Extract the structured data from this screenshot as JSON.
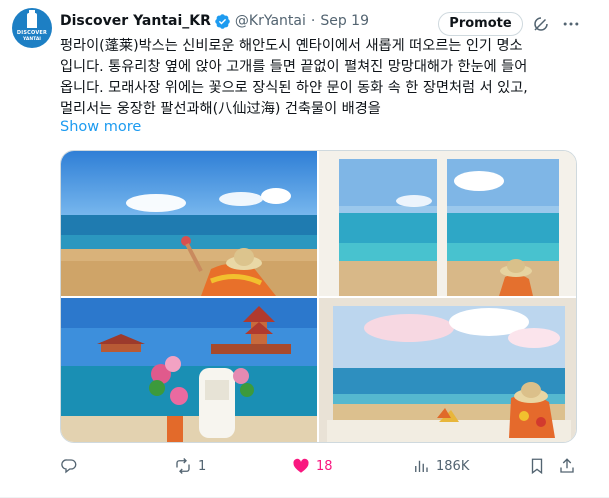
{
  "account": {
    "avatar_line1": "DISCOVER",
    "avatar_line2": "YANTAI",
    "display_name": "Discover Yantai_KR",
    "handle": "@KrYantai",
    "separator": "·",
    "date": "Sep 19",
    "verified_icon": "verified-badge-icon"
  },
  "header_actions": {
    "promote_label": "Promote",
    "grok_icon": "grok-icon",
    "more_icon": "more-icon"
  },
  "post": {
    "lines": [
      "펑라이(蓬莱)박스는 신비로운 해안도시 옌타이에서 새롭게 떠오르는 인기 명소",
      "입니다. 통유리창 옆에 앉아 고개를 들면 끝없이 펼쳐진 망망대해가 한눈에 들어",
      "옵니다. 모래사장 위에는 꽃으로 장식된 하얀 문이 동화 속 한 장면처럼 서 있고,",
      "멀리서는 웅장한 팔선과해(八仙过海) 건축물이 배경을"
    ],
    "show_more": "Show more"
  },
  "media": {
    "photos": [
      "photo-beach-sitting",
      "photo-window-ocean",
      "photo-flower-door-pavilion",
      "photo-window-ledge-ocean"
    ]
  },
  "actions": {
    "reply": {
      "icon": "reply-icon",
      "count": ""
    },
    "repost": {
      "icon": "repost-icon",
      "count": "1"
    },
    "like": {
      "icon": "heart-icon",
      "count": "18",
      "color": "#f91880"
    },
    "views": {
      "icon": "views-icon",
      "count": "186K"
    },
    "bookmark": {
      "icon": "bookmark-icon"
    },
    "share": {
      "icon": "share-icon"
    }
  },
  "colors": {
    "link": "#1d9bf0",
    "secondary_text": "#536471",
    "primary_text": "#0f1419",
    "verified": "#1d9bf0"
  }
}
